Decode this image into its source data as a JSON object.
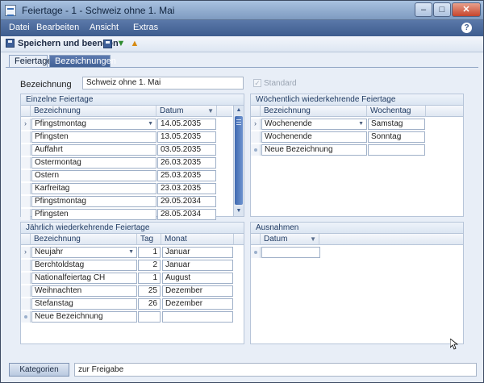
{
  "window": {
    "title": "Feiertage - 1 - Schweiz ohne 1. Mai",
    "min_glyph": "–",
    "max_glyph": "□",
    "close_glyph": "✕"
  },
  "menu": {
    "items": [
      "Datei",
      "Bearbeiten",
      "Ansicht",
      "Extras"
    ],
    "help_glyph": "?"
  },
  "toolbar": {
    "save_close_label": "Speichern und beenden"
  },
  "tabs": [
    {
      "label": "Feiertage",
      "active": true
    },
    {
      "label": "Bezeichnungen",
      "active": false
    }
  ],
  "form": {
    "name_label": "Bezeichnung",
    "name_value": "Schweiz ohne 1. Mai",
    "standard_label": "Standard",
    "standard_checked": true
  },
  "einzelne": {
    "title": "Einzelne Feiertage",
    "columns": [
      "Bezeichnung",
      "Datum"
    ],
    "rows": [
      {
        "name": "Pfingstmontag",
        "date": "14.05.2035"
      },
      {
        "name": "Pfingsten",
        "date": "13.05.2035"
      },
      {
        "name": "Auffahrt",
        "date": "03.05.2035"
      },
      {
        "name": "Ostermontag",
        "date": "26.03.2035"
      },
      {
        "name": "Ostern",
        "date": "25.03.2035"
      },
      {
        "name": "Karfreitag",
        "date": "23.03.2035"
      },
      {
        "name": "Pfingstmontag",
        "date": "29.05.2034"
      },
      {
        "name": "Pfingsten",
        "date": "28.05.2034"
      }
    ]
  },
  "woechentlich": {
    "title": "Wöchentlich wiederkehrende Feiertage",
    "columns": [
      "Bezeichnung",
      "Wochentag"
    ],
    "rows": [
      {
        "name": "Wochenende",
        "day": "Samstag"
      },
      {
        "name": "Wochenende",
        "day": "Sonntag"
      }
    ],
    "new_row": "Neue Bezeichnung"
  },
  "jaehrlich": {
    "title": "Jährlich wiederkehrende Feiertage",
    "columns": [
      "Bezeichnung",
      "Tag",
      "Monat"
    ],
    "rows": [
      {
        "name": "Neujahr",
        "day": "1",
        "month": "Januar"
      },
      {
        "name": "Berchtoldstag",
        "day": "2",
        "month": "Januar"
      },
      {
        "name": "Nationalfeiertag CH",
        "day": "1",
        "month": "August"
      },
      {
        "name": "Weihnachten",
        "day": "25",
        "month": "Dezember"
      },
      {
        "name": "Stefanstag",
        "day": "26",
        "month": "Dezember"
      }
    ],
    "new_row": "Neue Bezeichnung"
  },
  "ausnahmen": {
    "title": "Ausnahmen",
    "columns": [
      "Datum"
    ]
  },
  "footer": {
    "kategorien_label": "Kategorien",
    "status_text": "zur Freigabe"
  }
}
